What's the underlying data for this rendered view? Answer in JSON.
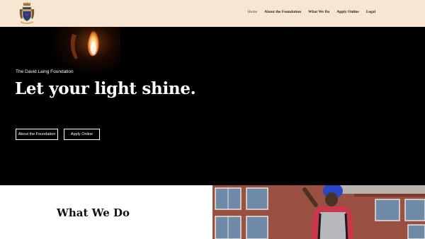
{
  "header": {
    "logo_icon": "coat-of-arms-icon",
    "nav": [
      {
        "label": "Home",
        "active": true
      },
      {
        "label": "About the Foundation",
        "active": false
      },
      {
        "label": "What We Do",
        "active": false
      },
      {
        "label": "Apply Online",
        "active": false
      },
      {
        "label": "Legal",
        "active": false
      }
    ]
  },
  "hero": {
    "kicker": "The David Laing Foundation",
    "title": "Let your light shine.",
    "buttons": {
      "about_label": "About the Foundation",
      "apply_label": "Apply Online"
    },
    "image_icon": "candle-flame-icon"
  },
  "section": {
    "title": "What We Do",
    "photo_icon": "person-in-helmet-photo"
  },
  "colors": {
    "header_bg": "#f6e6d3",
    "hero_bg": "#000000",
    "text_dark": "#111111",
    "text_light": "#ffffff"
  }
}
